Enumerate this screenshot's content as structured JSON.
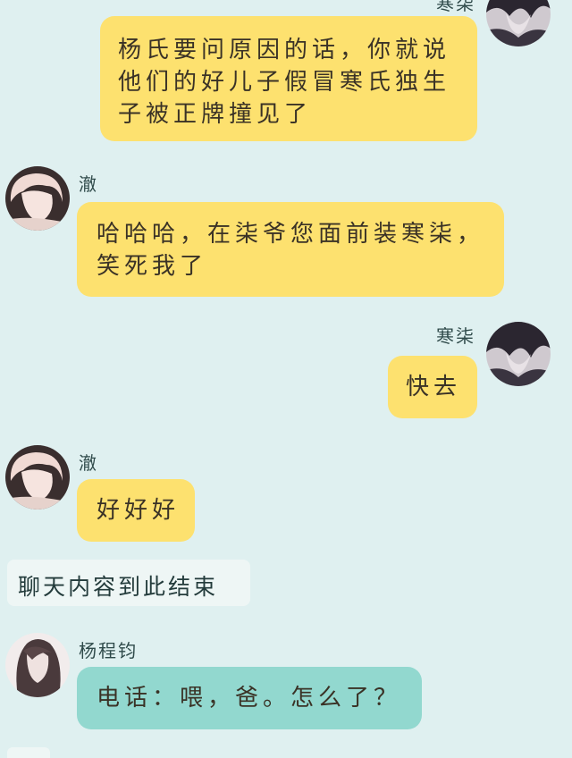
{
  "messages": [
    {
      "sender": "寒柒",
      "text": "杨氏要问原因的话，你就说他们的好儿子假冒寒氏独生子被正牌撞见了",
      "avatar": "dark-hair-boy-avatar"
    },
    {
      "sender": "澈",
      "text": "哈哈哈，在柒爷您面前装寒柒，笑死我了",
      "avatar": "light-hair-boy-avatar"
    },
    {
      "sender": "寒柒",
      "text": "快去",
      "avatar": "dark-hair-boy-avatar"
    },
    {
      "sender": "澈",
      "text": "好好好",
      "avatar": "light-hair-boy-avatar"
    }
  ],
  "system_notice": "聊天内容到此结束",
  "phone_message": {
    "sender": "杨程钧",
    "text": "电话：喂，爸。怎么了？",
    "avatar": "long-hair-avatar"
  },
  "colors": {
    "background": "#dff0f0",
    "yellow_bubble": "#fde16f",
    "teal_bubble": "#92d8cf",
    "system_box": "#eef6f5"
  }
}
